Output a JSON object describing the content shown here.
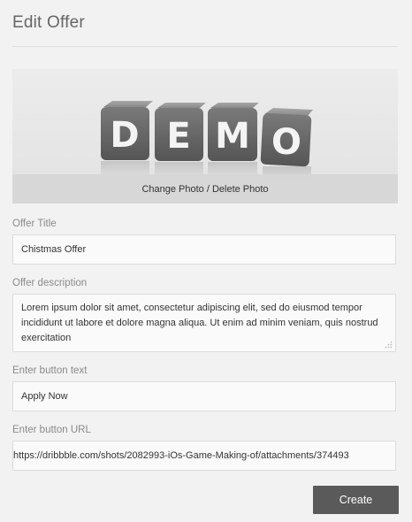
{
  "page": {
    "title": "Edit Offer"
  },
  "photo": {
    "letters": [
      "D",
      "E",
      "M",
      "O"
    ],
    "action_label": "Change Photo / Delete Photo"
  },
  "form": {
    "offer_title": {
      "label": "Offer Title",
      "value": "Chistmas Offer"
    },
    "offer_description": {
      "label": "Offer description",
      "value": "Lorem ipsum dolor sit amet, consectetur adipiscing elit, sed do eiusmod tempor incididunt ut labore et dolore magna aliqua. Ut enim ad minim veniam, quis nostrud exercitation"
    },
    "button_text": {
      "label": "Enter button text",
      "value": "Apply Now"
    },
    "button_url": {
      "label": "Enter button URL",
      "value": "https://dribbble.com/shots/2082993-iOs-Game-Making-of/attachments/374493"
    }
  },
  "actions": {
    "create_label": "Create"
  }
}
